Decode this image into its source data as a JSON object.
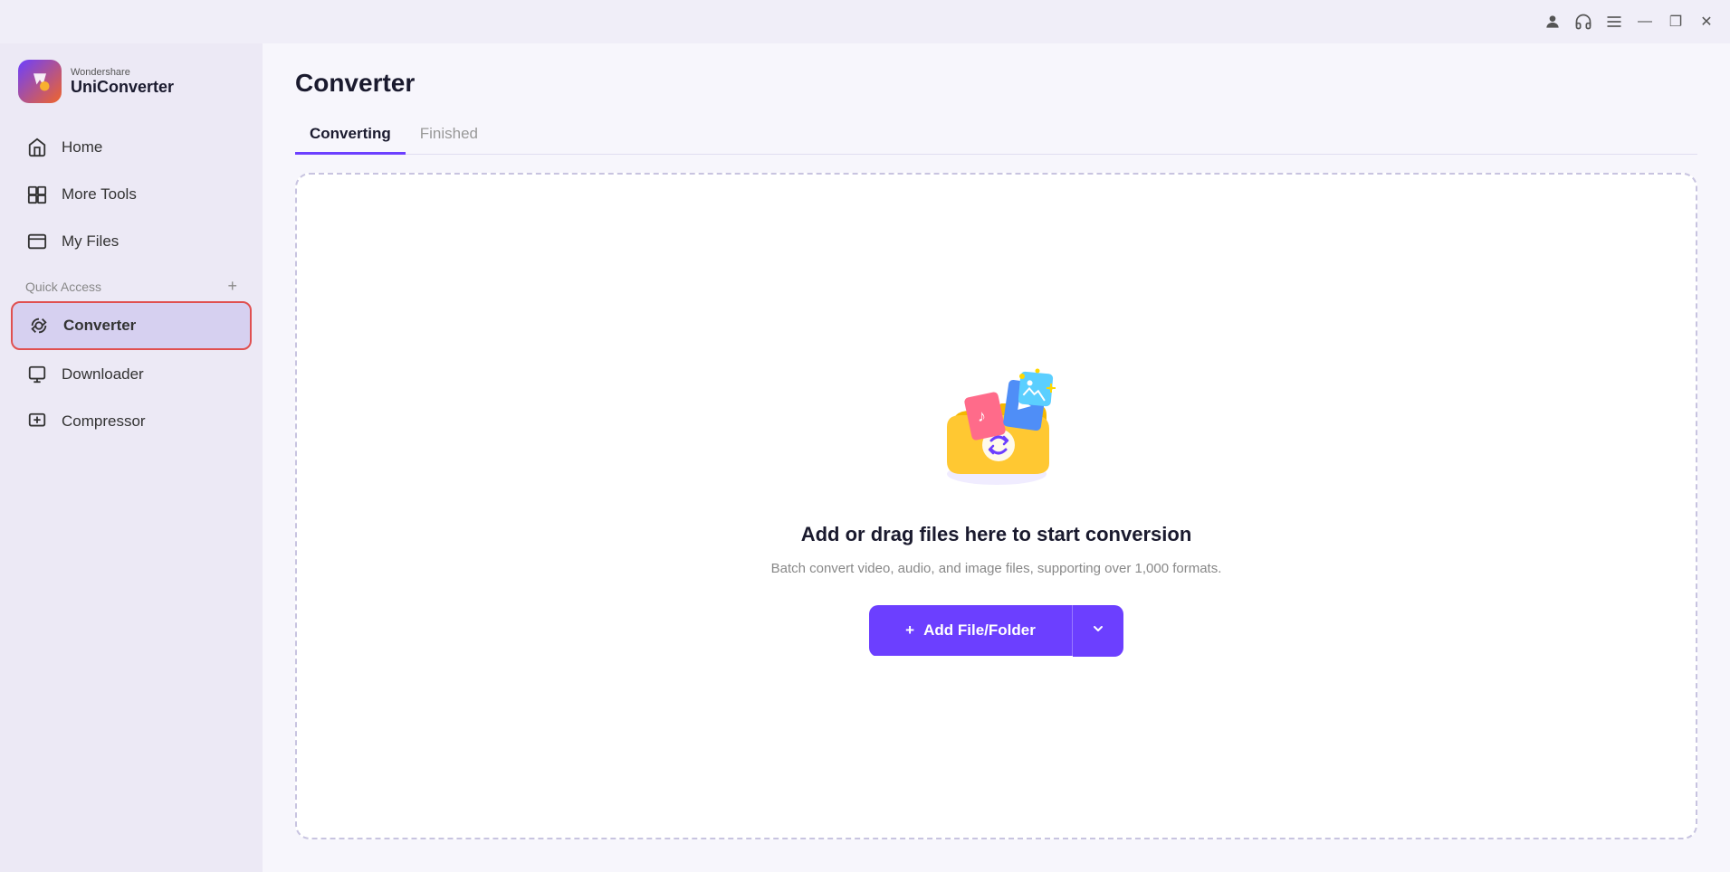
{
  "titlebar": {
    "controls": {
      "minimize": "—",
      "maximize": "❐",
      "close": "✕"
    }
  },
  "sidebar": {
    "logo": {
      "brand": "Wondershare",
      "product": "UniConverter"
    },
    "nav_items": [
      {
        "id": "home",
        "label": "Home",
        "icon": "home-icon"
      },
      {
        "id": "more-tools",
        "label": "More Tools",
        "icon": "more-tools-icon"
      },
      {
        "id": "my-files",
        "label": "My Files",
        "icon": "my-files-icon"
      }
    ],
    "quick_access_label": "Quick Access",
    "quick_access_items": [
      {
        "id": "converter",
        "label": "Converter",
        "icon": "converter-icon",
        "active": true
      },
      {
        "id": "downloader",
        "label": "Downloader",
        "icon": "downloader-icon"
      },
      {
        "id": "compressor",
        "label": "Compressor",
        "icon": "compressor-icon"
      }
    ]
  },
  "main": {
    "page_title": "Converter",
    "tabs": [
      {
        "id": "converting",
        "label": "Converting",
        "active": true
      },
      {
        "id": "finished",
        "label": "Finished",
        "active": false
      }
    ],
    "dropzone": {
      "title": "Add or drag files here to start conversion",
      "subtitle": "Batch convert video, audio, and image files, supporting over 1,000 formats.",
      "button_label": "Add File/Folder",
      "button_plus": "+"
    }
  },
  "colors": {
    "accent": "#6c3fff",
    "active_tab_underline": "#6c3fff",
    "sidebar_bg": "#ece9f5",
    "active_nav_bg": "#d6d0f0",
    "main_bg": "#f7f6fc",
    "border_active": "#e05050"
  }
}
